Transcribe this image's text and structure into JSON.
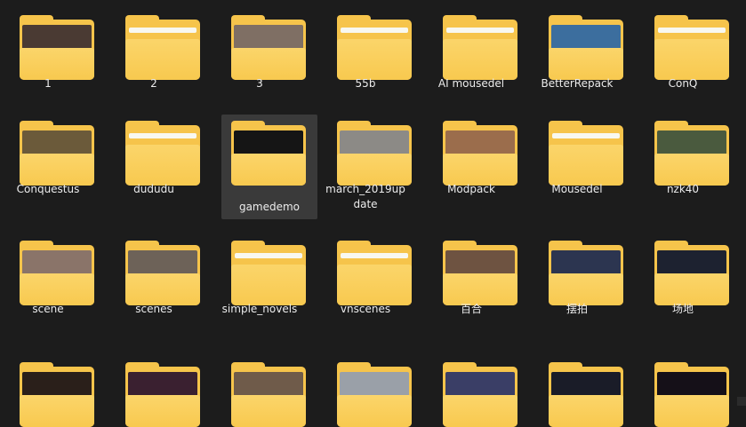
{
  "folders": [
    {
      "label": "1",
      "thumb": "#4a3a33"
    },
    {
      "label": "2",
      "thumb": ""
    },
    {
      "label": "3",
      "thumb": "#7f6f64"
    },
    {
      "label": "55b",
      "thumb": ""
    },
    {
      "label": "AI mousedel",
      "thumb": ""
    },
    {
      "label": "BetterRepack",
      "thumb": "#3c6e9e"
    },
    {
      "label": "ConQ",
      "thumb": ""
    },
    {
      "label": "Conquestus",
      "thumb": "#6b5a3a"
    },
    {
      "label": "dududu",
      "thumb": ""
    },
    {
      "label": "gamedemo",
      "thumb": "#151515"
    },
    {
      "label": "march_2019update",
      "thumb": "#8c8a86"
    },
    {
      "label": "Modpack",
      "thumb": "#9b6d4c"
    },
    {
      "label": "Mousedel",
      "thumb": ""
    },
    {
      "label": "nzk40",
      "thumb": "#4a5a3e"
    },
    {
      "label": "scene",
      "thumb": "#8a7469"
    },
    {
      "label": "scenes",
      "thumb": "#6d6258"
    },
    {
      "label": "simple_novels",
      "thumb": ""
    },
    {
      "label": "vnscenes",
      "thumb": ""
    },
    {
      "label": "百合",
      "thumb": "#6e5341"
    },
    {
      "label": "摆拍",
      "thumb": "#2c3550"
    },
    {
      "label": "场地",
      "thumb": "#1d2230"
    },
    {
      "label": "",
      "thumb": "#2a1f1a"
    },
    {
      "label": "",
      "thumb": "#3a2030"
    },
    {
      "label": "",
      "thumb": "#6f5b4a"
    },
    {
      "label": "",
      "thumb": "#9aa0a8"
    },
    {
      "label": "",
      "thumb": "#3a3e66"
    },
    {
      "label": "",
      "thumb": "#1a1c28"
    },
    {
      "label": "",
      "thumb": "#151018"
    }
  ],
  "selected_label": "gamedemo"
}
